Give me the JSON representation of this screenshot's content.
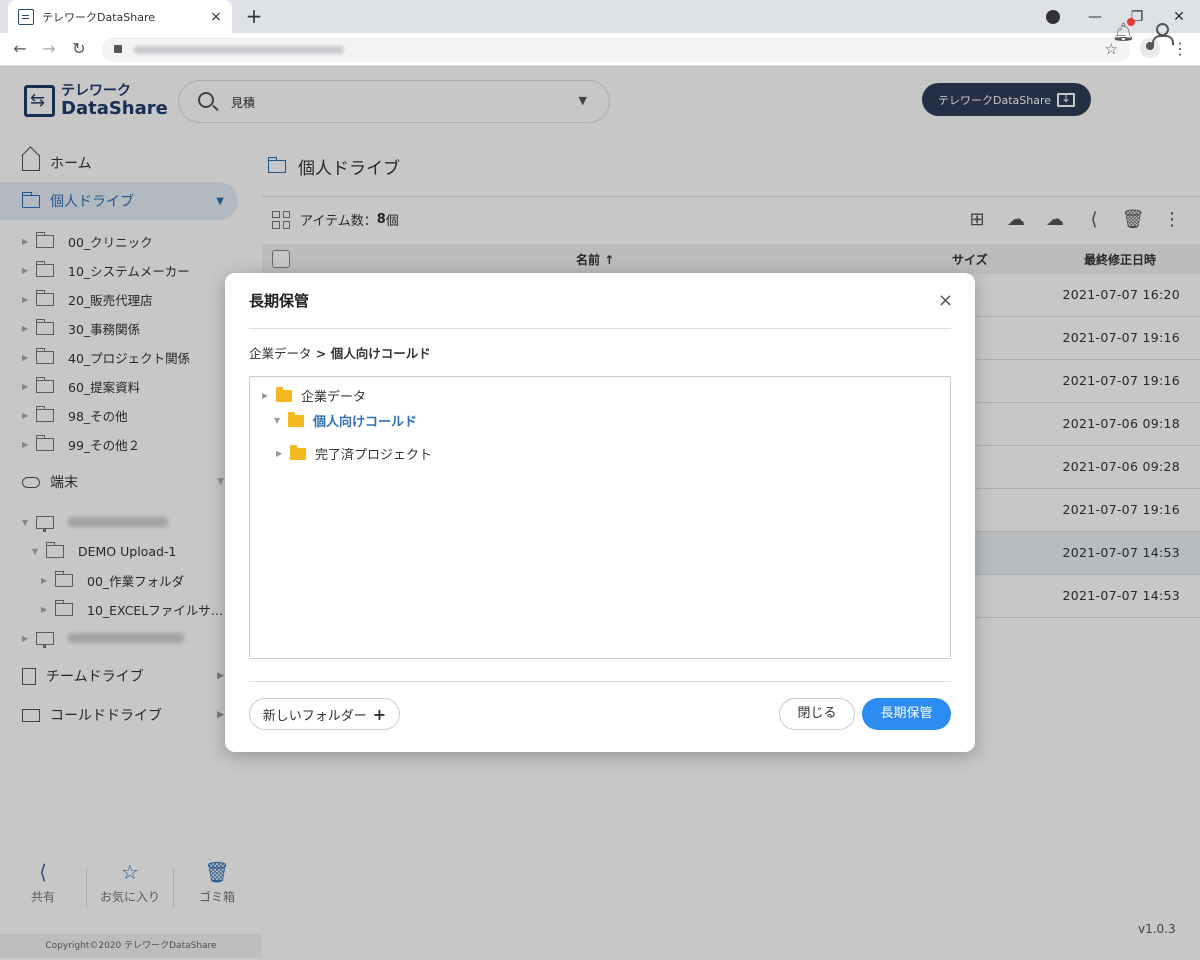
{
  "browser": {
    "tab_title": "テレワークDataShare",
    "tab_close": "×",
    "new_tab": "+"
  },
  "header": {
    "logo_line1": "テレワーク",
    "logo_line2": "DataShare",
    "search_value": "見積",
    "download_button": "テレワークDataShare"
  },
  "sidebar": {
    "home": "ホーム",
    "personal_drive": "個人ドライブ",
    "folders": [
      "00_クリニック",
      "10_システムメーカー",
      "20_販売代理店",
      "30_事務関係",
      "40_プロジェクト関係",
      "60_提案資料",
      "98_その他",
      "99_その他２"
    ],
    "terminal": "端末",
    "device_folder": "DEMO Upload-1",
    "device_subfolders": [
      "00_作業フォルダ",
      "10_EXCELファイルサ…"
    ],
    "team_drive": "チームドライブ",
    "cold_drive": "コールドドライブ",
    "actions": {
      "share": "共有",
      "favorites": "お気に入り",
      "trash": "ゴミ箱"
    },
    "copyright": "Copyright©2020 テレワークDataShare"
  },
  "main": {
    "title": "個人ドライブ",
    "item_count_label": "アイテム数：",
    "item_count_value": "8",
    "item_count_unit": " 個",
    "columns": {
      "name": "名前",
      "size": "サイズ",
      "modified": "最終修正日時"
    },
    "rows": [
      {
        "modified": "2021-07-07 16:20"
      },
      {
        "modified": "2021-07-07 19:16"
      },
      {
        "modified": "2021-07-07 19:16"
      },
      {
        "modified": "2021-07-06 09:18"
      },
      {
        "modified": "2021-07-06 09:28"
      },
      {
        "modified": "2021-07-07 19:16"
      },
      {
        "modified": "2021-07-07 14:53"
      },
      {
        "modified": "2021-07-07 14:53"
      }
    ],
    "version": "v1.0.3"
  },
  "modal": {
    "title": "長期保管",
    "close_icon": "×",
    "breadcrumb_root": "企業データ",
    "breadcrumb_sep": " > ",
    "breadcrumb_current": "個人向けコールド",
    "tree": [
      {
        "label": "企業データ"
      },
      {
        "label": "個人向けコールド"
      },
      {
        "label": "完了済プロジェクト"
      }
    ],
    "new_folder_button": "新しいフォルダー",
    "new_folder_plus": "+",
    "close_button": "閉じる",
    "archive_button": "長期保管"
  },
  "colors": {
    "accent": "#2d8cf0",
    "brand_navy": "#1f3b69",
    "active_nav": "#2f6fb5",
    "folder_yellow": "#f5b820",
    "notification": "#e53935"
  }
}
